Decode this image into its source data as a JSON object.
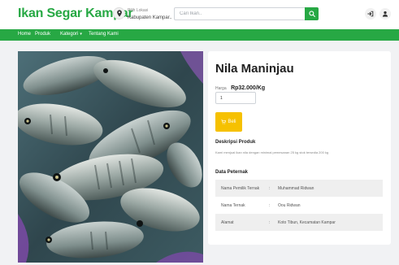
{
  "header": {
    "brand": "Ikan Segar Kampar",
    "location_label": "Pilih Lokasi",
    "location_value": "Kabupaten Kampar..",
    "search_placeholder": "Cari Ikan..",
    "search_icon": "search-icon",
    "cart_icon": "login-icon",
    "user_icon": "user-icon"
  },
  "nav": {
    "items": [
      {
        "label": "Home"
      },
      {
        "label": "Produk"
      },
      {
        "label": "Kategori"
      },
      {
        "label": "Tentang Kami"
      }
    ],
    "dropdown_caret": "▾"
  },
  "product": {
    "title": "Nila Maninjau",
    "price_label": "Harga",
    "price_value": "Rp32.000/Kg",
    "quantity": "1",
    "buy_label": "Beli",
    "description_heading": "Deskripsi Produk",
    "description_text": "Kami menjual ikan nila dengan minimal pemesanan 25 kg stok tersedia 200 kg",
    "breeder_heading": "Data Peternak",
    "breeder": [
      {
        "key": "Nama Pemilik Ternak",
        "sep": ":",
        "value": "Muhammad Ridwan"
      },
      {
        "key": "Nama Ternak",
        "sep": ":",
        "value": "Oou Ridwan"
      },
      {
        "key": "Alamat",
        "sep": ":",
        "value": "Koto Tibun, Kecamatan Kampar"
      }
    ]
  },
  "colors": {
    "brand_green": "#27a844",
    "buy_yellow": "#f6c100"
  }
}
